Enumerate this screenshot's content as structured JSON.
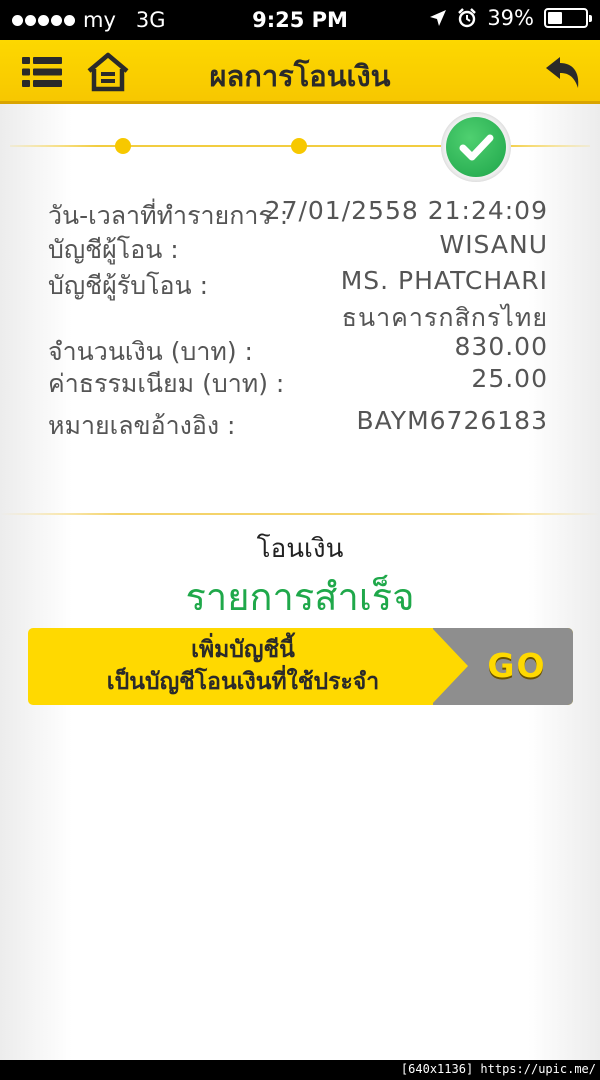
{
  "status_bar": {
    "carrier": "my",
    "network": "3G",
    "time": "9:25 PM",
    "battery": "39%",
    "battery_level": 0.39
  },
  "header": {
    "title": "ผลการโอนเงิน",
    "menu_icon": "list-menu-icon",
    "home_icon": "home-icon",
    "back_icon": "back-arrow-icon"
  },
  "stepper": {
    "steps_total": 3,
    "current_step": 3,
    "done_icon": "check-icon"
  },
  "details": {
    "datetime_label": "วัน-เวลาที่ทำรายการ :",
    "datetime_value": "27/01/2558 21:24:09",
    "from_label": "บัญชีผู้โอน :",
    "from_value": "WISANU",
    "to_label": "บัญชีผู้รับโอน :",
    "to_name": "MS. PHATCHARI",
    "to_bank": "ธนาคารกสิกรไทย",
    "amount_label": "จำนวนเงิน (บาท) :",
    "amount_value": "830.00",
    "fee_label": "ค่าธรรมเนียม (บาท) :",
    "fee_value": "25.00",
    "ref_label": "หมายเลขอ้างอิง :",
    "ref_value": "BAYM6726183"
  },
  "result": {
    "caption": "โอนเงิน",
    "status": "รายการสำเร็จ",
    "status_color": "#1fa84a"
  },
  "favorite_banner": {
    "line1": "เพิ่มบัญชีนี้",
    "line2": "เป็นบัญชีโอนเงินที่ใช้ประจำ",
    "go_label": "GO"
  },
  "colors": {
    "brand_yellow": "#fdd800",
    "accent_green": "#1fa84a",
    "go_gray": "#8e8e8e"
  },
  "watermark": "[640x1136] https://upic.me/"
}
